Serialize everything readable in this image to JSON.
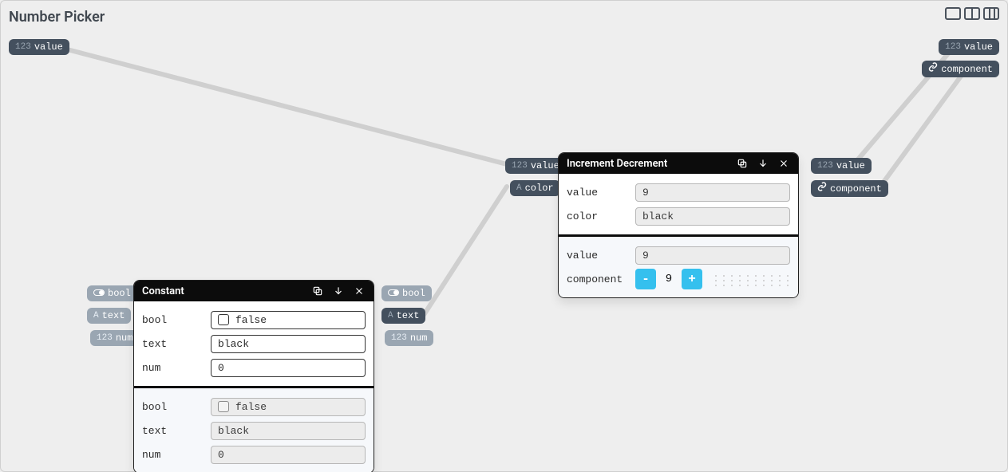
{
  "page": {
    "title": "Number Picker"
  },
  "pills": {
    "topLeftValue": {
      "prefix": "123",
      "label": "value"
    },
    "topRightValue": {
      "prefix": "123",
      "label": "value"
    },
    "topRightComponent": {
      "label": "component"
    },
    "midValue": {
      "prefix": "123",
      "label": "value"
    },
    "midColor": {
      "prefix": "A",
      "label": "color"
    },
    "idOutValue": {
      "prefix": "123",
      "label": "value"
    },
    "idOutComponent": {
      "label": "component"
    },
    "constInBool": {
      "label": "bool"
    },
    "constInText": {
      "prefix": "A",
      "label": "text"
    },
    "constInNum": {
      "prefix": "123",
      "label": "num"
    },
    "constOutBool": {
      "label": "bool"
    },
    "constOutText": {
      "prefix": "A",
      "label": "text"
    },
    "constOutNum": {
      "prefix": "123",
      "label": "num"
    }
  },
  "nodes": {
    "constant": {
      "title": "Constant",
      "inputs": {
        "bool": {
          "label": "bool",
          "value": "false"
        },
        "text": {
          "label": "text",
          "value": "black"
        },
        "num": {
          "label": "num",
          "value": "0"
        }
      },
      "outputs": {
        "bool": {
          "label": "bool",
          "value": "false"
        },
        "text": {
          "label": "text",
          "value": "black"
        },
        "num": {
          "label": "num",
          "value": "0"
        }
      }
    },
    "id": {
      "title": "Increment Decrement",
      "inputs": {
        "value": {
          "label": "value",
          "value": "9"
        },
        "color": {
          "label": "color",
          "value": "black"
        }
      },
      "outputs": {
        "value": {
          "label": "value",
          "value": "9"
        },
        "component": {
          "label": "component",
          "minus": "-",
          "display": "9",
          "plus": "+"
        }
      }
    }
  }
}
